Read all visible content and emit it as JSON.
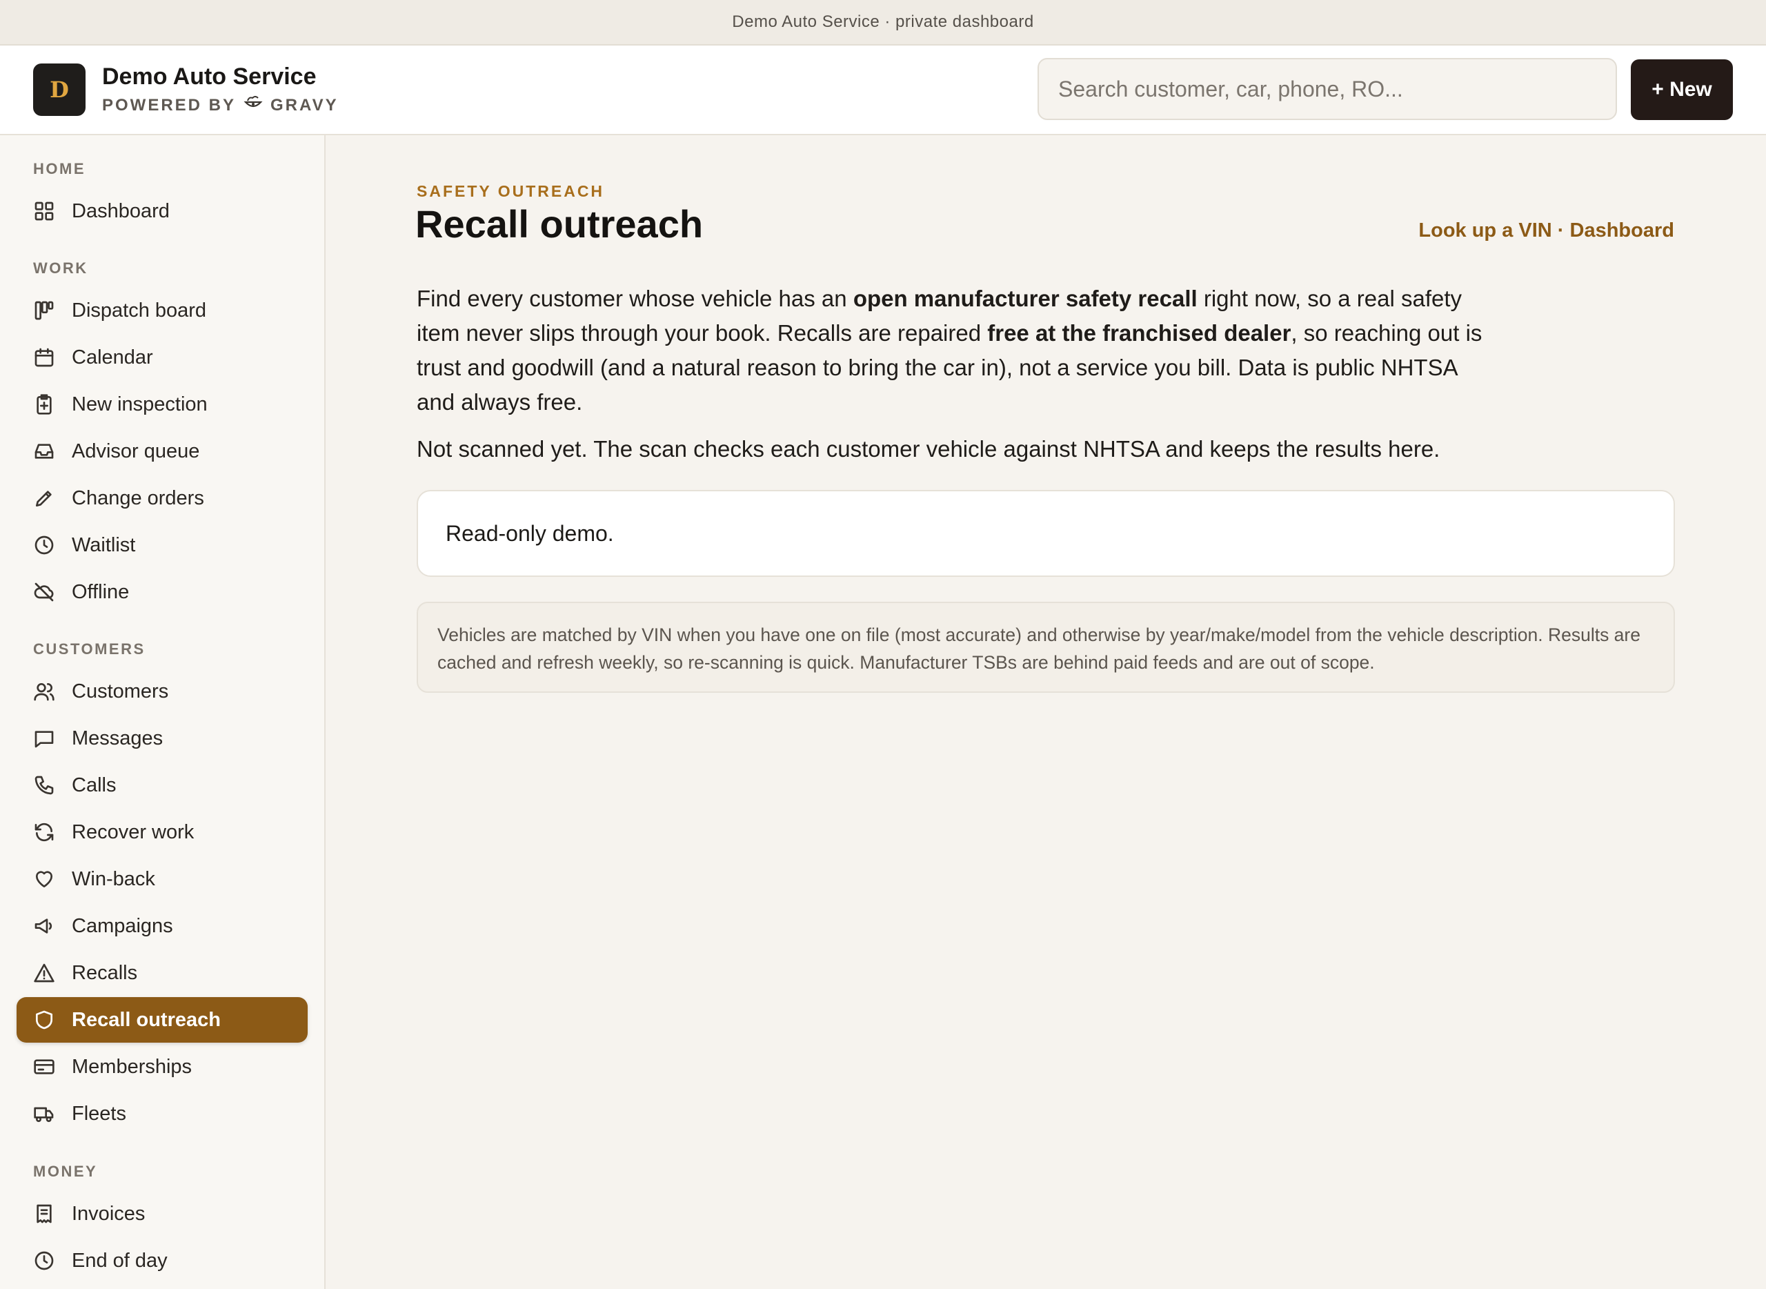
{
  "banner": {
    "text": "Demo Auto Service · private dashboard"
  },
  "header": {
    "logo_letter": "D",
    "brand_name": "Demo Auto Service",
    "powered_by": "POWERED BY",
    "powered_brand": "GRAVY",
    "search_placeholder": "Search customer, car, phone, RO...",
    "new_button": "+ New"
  },
  "sidebar": {
    "sections": [
      {
        "label": "HOME",
        "items": [
          {
            "label": "Dashboard",
            "icon": "grid-icon"
          }
        ]
      },
      {
        "label": "WORK",
        "items": [
          {
            "label": "Dispatch board",
            "icon": "kanban-icon"
          },
          {
            "label": "Calendar",
            "icon": "calendar-icon"
          },
          {
            "label": "New inspection",
            "icon": "clipboard-plus-icon"
          },
          {
            "label": "Advisor queue",
            "icon": "inbox-icon"
          },
          {
            "label": "Change orders",
            "icon": "pencil-icon"
          },
          {
            "label": "Waitlist",
            "icon": "clock-icon"
          },
          {
            "label": "Offline",
            "icon": "cloud-off-icon"
          }
        ]
      },
      {
        "label": "CUSTOMERS",
        "items": [
          {
            "label": "Customers",
            "icon": "users-icon"
          },
          {
            "label": "Messages",
            "icon": "message-icon"
          },
          {
            "label": "Calls",
            "icon": "phone-icon"
          },
          {
            "label": "Recover work",
            "icon": "refresh-icon"
          },
          {
            "label": "Win-back",
            "icon": "heart-icon"
          },
          {
            "label": "Campaigns",
            "icon": "megaphone-icon"
          },
          {
            "label": "Recalls",
            "icon": "warning-icon"
          },
          {
            "label": "Recall outreach",
            "icon": "shield-icon",
            "active": true
          },
          {
            "label": "Memberships",
            "icon": "card-icon"
          },
          {
            "label": "Fleets",
            "icon": "truck-icon"
          }
        ]
      },
      {
        "label": "MONEY",
        "items": [
          {
            "label": "Invoices",
            "icon": "receipt-icon"
          },
          {
            "label": "End of day",
            "icon": "clock-icon"
          }
        ]
      }
    ]
  },
  "main": {
    "eyebrow": "SAFETY OUTREACH",
    "title": "Recall outreach",
    "links": {
      "vin": "Look up a VIN",
      "sep": " · ",
      "dashboard": "Dashboard"
    },
    "intro": {
      "p1": "Find every customer whose vehicle has an ",
      "b1": "open manufacturer safety recall",
      "p2": " right now, so a real safety item never slips through your book. Recalls are repaired ",
      "b2": "free at the franchised dealer",
      "p3": ", so reaching out is trust and goodwill (and a natural reason to bring the car in), not a service you bill. Data is public NHTSA and always free."
    },
    "status": "Not scanned yet. The scan checks each customer vehicle against NHTSA and keeps the results here.",
    "card_text": "Read-only demo.",
    "note": "Vehicles are matched by VIN when you have one on file (most accurate) and otherwise by year/make/model from the vehicle description. Results are cached and refresh weekly, so re-scanning is quick. Manufacturer TSBs are behind paid feeds and are out of scope."
  },
  "colors": {
    "accent": "#8c5a16",
    "eyebrow": "#a86e1c",
    "dark_button": "#241a17",
    "background": "#f6f3ee"
  }
}
